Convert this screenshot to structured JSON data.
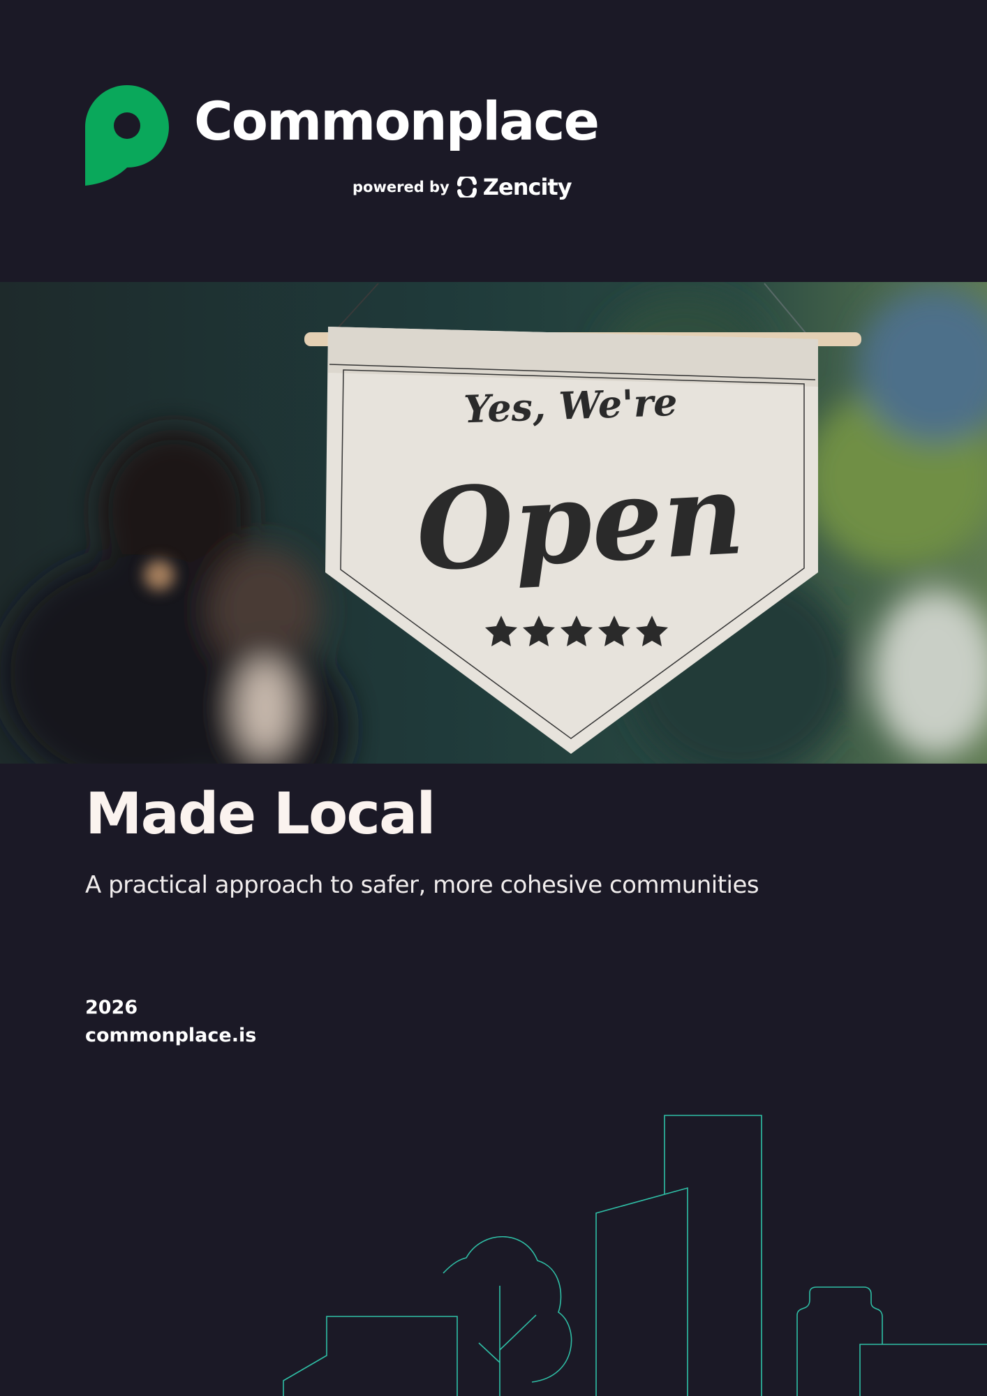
{
  "brand": {
    "name": "Commonplace",
    "powered_by": "powered by",
    "partner": "Zencity",
    "logo_color": "#0aa85b"
  },
  "hero_image": {
    "sign": {
      "line1": "Yes, We're",
      "line2": "Open"
    }
  },
  "cover": {
    "title": "Made Local",
    "subtitle": "A practical approach to safer, more cohesive communities",
    "year": "2026",
    "website": "commonplace.is"
  },
  "colors": {
    "background": "#1b1926",
    "skyline_stroke": "#2fbfa6"
  }
}
